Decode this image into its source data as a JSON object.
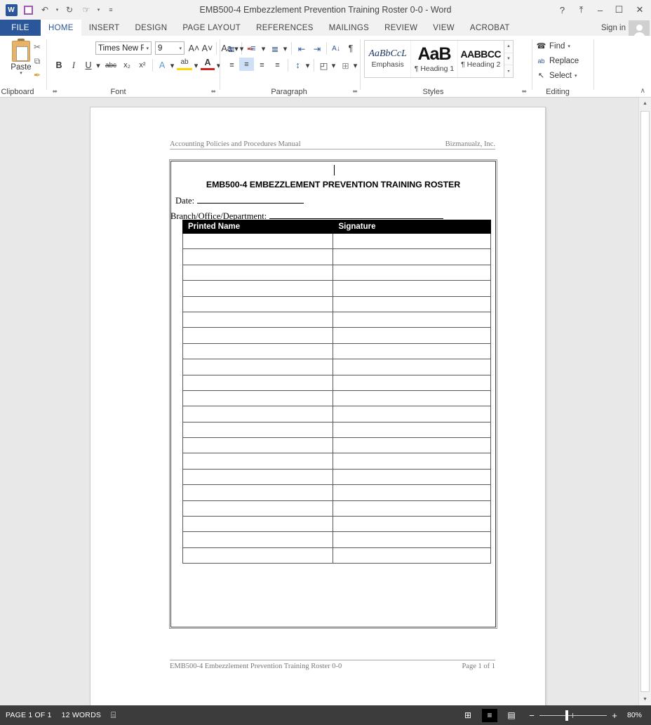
{
  "window": {
    "title": "EMB500-4 Embezzlement Prevention Training Roster 0-0 - Word",
    "app_logo": "W",
    "help_label": "?",
    "ribbon_display_label": "⤒",
    "minimize_label": "–",
    "maximize_label": "☐",
    "close_label": "✕",
    "sign_in_label": "Sign in"
  },
  "quick_access": {
    "save_name": "save-icon",
    "undo_label": "↶",
    "undo_dd": "▾",
    "redo_label": "↻",
    "touch_label": "☞",
    "touch_dd": "▾",
    "customize_label": "≡"
  },
  "tabs": [
    {
      "label": "FILE",
      "active": false
    },
    {
      "label": "HOME",
      "active": true
    },
    {
      "label": "INSERT",
      "active": false
    },
    {
      "label": "DESIGN",
      "active": false
    },
    {
      "label": "PAGE LAYOUT",
      "active": false
    },
    {
      "label": "REFERENCES",
      "active": false
    },
    {
      "label": "MAILINGS",
      "active": false
    },
    {
      "label": "REVIEW",
      "active": false
    },
    {
      "label": "VIEW",
      "active": false
    },
    {
      "label": "ACROBAT",
      "active": false
    }
  ],
  "ribbon": {
    "clipboard": {
      "label": "Clipboard",
      "paste_label": "Paste",
      "paste_dd": "▾",
      "cut_label": "✂",
      "copy_label": "⧉",
      "format_painter_label": "✒",
      "launcher": "⬌"
    },
    "font": {
      "label": "Font",
      "font_name": "Times New Ro",
      "font_size": "9",
      "grow_label": "A˄",
      "shrink_label": "A˅",
      "change_case_label": "Aa",
      "clear_format_label": "✒",
      "bold_label": "B",
      "italic_label": "I",
      "underline_label": "U",
      "underline_dd": "▾",
      "strike_label": "abc",
      "subscript_label": "x₂",
      "superscript_label": "x²",
      "text_effects_label": "A",
      "highlight_label": "ab",
      "font_color_label": "A",
      "dd": "▾",
      "launcher": "⬌"
    },
    "paragraph": {
      "label": "Paragraph",
      "bullets_label": "≣",
      "numbering_label": "≡",
      "multilevel_label": "≣",
      "decrease_indent_label": "⇤",
      "increase_indent_label": "⇥",
      "sort_label": "A↓",
      "marks_label": "¶",
      "align_left_label": "≡",
      "align_center_label": "≡",
      "align_right_label": "≡",
      "justify_label": "≡",
      "line_spacing_label": "↕",
      "shading_label": "◰",
      "borders_label": "⊞",
      "dd": "▾",
      "launcher": "⬌"
    },
    "styles": {
      "label": "Styles",
      "items": [
        {
          "preview": "AaBbCcL",
          "name": "Emphasis",
          "preview_style": "emphasis"
        },
        {
          "preview": "AaB",
          "name": "¶ Heading 1",
          "preview_style": "heading1"
        },
        {
          "preview": "AABBCC",
          "name": "¶ Heading 2",
          "preview_style": "heading2"
        }
      ],
      "scroll_up": "▲",
      "scroll_down": "▼",
      "more": "▾",
      "launcher": "⬌"
    },
    "editing": {
      "label": "Editing",
      "find_label": "Find",
      "find_icon": "☎",
      "find_dd": "▾",
      "replace_label": "Replace",
      "replace_icon": "ab",
      "select_label": "Select",
      "select_icon": "↖",
      "select_dd": "▾"
    },
    "collapse_label": "∧"
  },
  "document": {
    "header_left": "Accounting Policies and Procedures Manual",
    "header_right": "Bizmanualz, Inc.",
    "form_title": "EMB500-4 EMBEZZLEMENT PREVENTION TRAINING ROSTER",
    "date_label": "Date:",
    "date_value": "",
    "branch_label": "Branch/Office/Department:",
    "branch_value": "",
    "table": {
      "columns": [
        "Printed Name",
        "Signature"
      ],
      "rows": [
        [
          "",
          ""
        ],
        [
          "",
          ""
        ],
        [
          "",
          ""
        ],
        [
          "",
          ""
        ],
        [
          "",
          ""
        ],
        [
          "",
          ""
        ],
        [
          "",
          ""
        ],
        [
          "",
          ""
        ],
        [
          "",
          ""
        ],
        [
          "",
          ""
        ],
        [
          "",
          ""
        ],
        [
          "",
          ""
        ],
        [
          "",
          ""
        ],
        [
          "",
          ""
        ],
        [
          "",
          ""
        ],
        [
          "",
          ""
        ],
        [
          "",
          ""
        ],
        [
          "",
          ""
        ],
        [
          "",
          ""
        ],
        [
          "",
          ""
        ],
        [
          "",
          ""
        ]
      ]
    },
    "footer_left": "EMB500-4 Embezzlement Prevention Training Roster 0-0",
    "footer_right": "Page 1 of 1"
  },
  "status_bar": {
    "page_info": "PAGE 1 OF 1",
    "word_count": "12 WORDS",
    "proofing_icon": "⌸",
    "read_mode_icon": "⊞",
    "print_layout_icon": "≡",
    "web_layout_icon": "▤",
    "zoom_out_label": "−",
    "zoom_in_label": "+",
    "zoom_level": "80%"
  },
  "colors": {
    "word_blue": "#2b579a",
    "ribbon_bg": "#ffffff",
    "status_bg": "#3c3c3c",
    "doc_bg": "#e8e8e8",
    "table_header_bg": "#000000"
  }
}
